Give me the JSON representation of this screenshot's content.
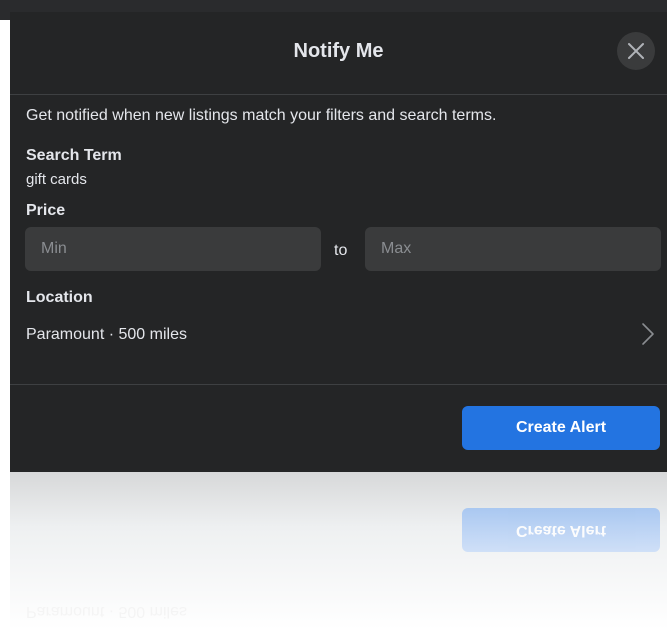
{
  "dialog": {
    "title": "Notify Me",
    "description": "Get notified when new listings match your filters and search terms.",
    "search_term": {
      "label": "Search Term",
      "value": "gift cards"
    },
    "price": {
      "label": "Price",
      "min_placeholder": "Min",
      "to_text": "to",
      "max_placeholder": "Max"
    },
    "location": {
      "label": "Location",
      "value": "Paramount · 500 miles"
    },
    "create_button_label": "Create Alert"
  },
  "icons": {
    "close": "close-icon",
    "chevron": "chevron-right-icon"
  },
  "colors": {
    "dialog_bg": "#242526",
    "field_bg": "#3a3b3c",
    "accent": "#2374e1",
    "text": "#e4e6eb"
  }
}
